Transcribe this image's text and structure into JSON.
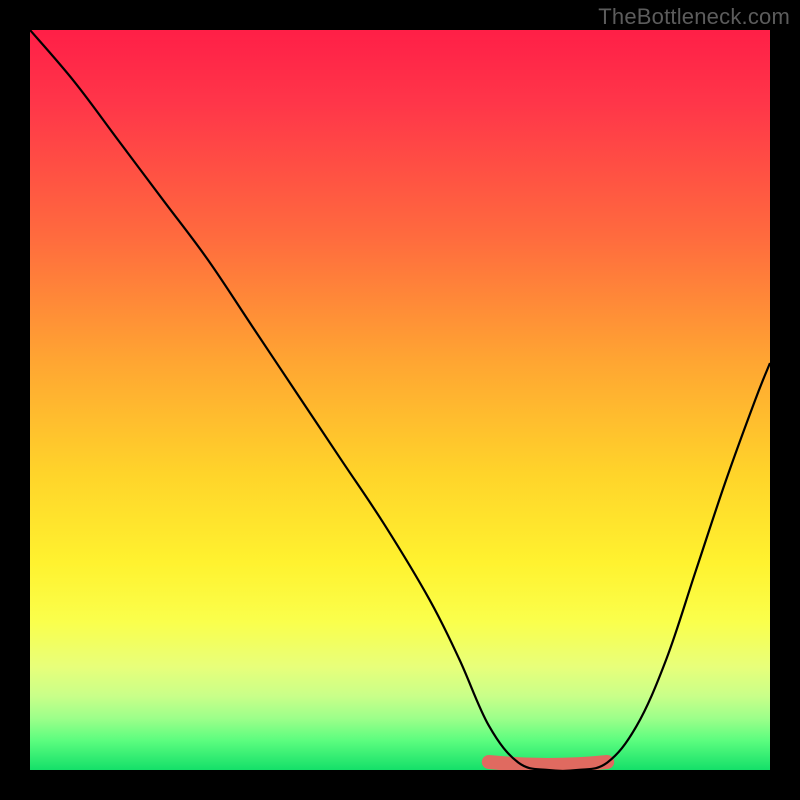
{
  "watermark": "TheBottleneck.com",
  "colors": {
    "frame": "#000000",
    "curve": "#000000",
    "accent_segment": "#e06a60",
    "gradient_top": "#ff1f47",
    "gradient_bottom": "#14e069"
  },
  "chart_data": {
    "type": "line",
    "title": "",
    "xlabel": "",
    "ylabel": "",
    "xlim": [
      0,
      100
    ],
    "ylim": [
      0,
      100
    ],
    "grid": false,
    "legend": false,
    "background": "rainbow vertical gradient (red top to green bottom)",
    "series": [
      {
        "name": "bottleneck-curve",
        "x": [
          0,
          6,
          12,
          18,
          24,
          30,
          36,
          42,
          48,
          54,
          58,
          62,
          66,
          70,
          74,
          78,
          82,
          86,
          90,
          94,
          98,
          100
        ],
        "y": [
          100,
          93,
          85,
          77,
          69,
          60,
          51,
          42,
          33,
          23,
          15,
          6,
          1,
          0,
          0,
          1,
          6,
          15,
          27,
          39,
          50,
          55
        ]
      }
    ],
    "annotations": [
      {
        "name": "optimal-range",
        "type": "highlight-segment",
        "x_range": [
          62,
          78
        ],
        "y": 0,
        "color": "#e06a60"
      }
    ]
  }
}
